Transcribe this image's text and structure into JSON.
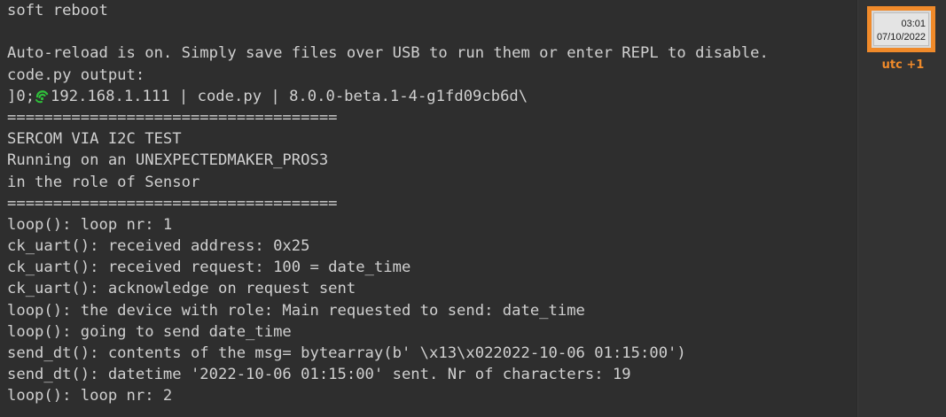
{
  "terminal": {
    "lines": {
      "l0": "soft reboot",
      "l1": "",
      "l2": "Auto-reload is on. Simply save files over USB to run them or enter REPL to disable.",
      "l3": "code.py output:",
      "l4_prefix": "]0;",
      "l4_rest": "192.168.1.111 | code.py | 8.0.0-beta.1-4-g1fd09cb6d\\",
      "l5": "====================================",
      "l6": "SERCOM VIA I2C TEST",
      "l7": "Running on an UNEXPECTEDMAKER_PROS3",
      "l8": "in the role of Sensor",
      "l9": "====================================",
      "l10": "loop(): loop nr: 1",
      "l11": "ck_uart(): received address: 0x25",
      "l12": "ck_uart(): received request: 100 = date_time",
      "l13": "ck_uart(): acknowledge on request sent",
      "l14": "loop(): the device with role: Main requested to send: date_time",
      "l15": "loop(): going to send date_time",
      "l16": "send_dt(): contents of the msg= bytearray(b' \\x13\\x022022-10-06 01:15:00')",
      "l17": "send_dt(): datetime '2022-10-06 01:15:00' sent. Nr of characters: 19",
      "l18": "loop(): loop nr: 2"
    },
    "icon": "wifi-icon",
    "icon_color": "#2fbf3a"
  },
  "clock": {
    "time": "03:01",
    "date": "07/10/2022",
    "timezone": "utc +1",
    "accent_color": "#f08a2a"
  }
}
